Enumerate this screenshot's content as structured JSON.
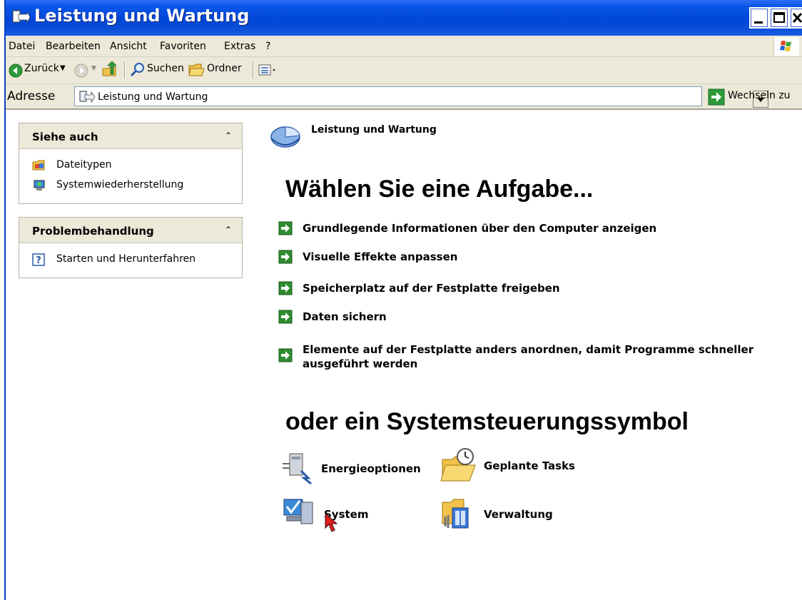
{
  "window": {
    "title": "Leistung und Wartung"
  },
  "menu": [
    "Datei",
    "Bearbeiten",
    "Ansicht",
    "Favoriten",
    "Extras",
    "?"
  ],
  "toolbar": {
    "back_label": "Zurück",
    "search_label": "Suchen",
    "folders_label": "Ordner"
  },
  "address": {
    "label": "Adresse",
    "value": "Leistung und Wartung",
    "go_label": "Wechseln zu"
  },
  "sidebar": {
    "see_also": {
      "title": "Siehe auch",
      "items": [
        "Dateitypen",
        "Systemwiederherstellung"
      ]
    },
    "troubleshoot": {
      "title": "Problembehandlung",
      "items": [
        "Starten und Herunterfahren"
      ]
    }
  },
  "main": {
    "category_title": "Leistung und Wartung",
    "task_heading": "Wählen Sie eine Aufgabe...",
    "tasks": [
      "Grundlegende Informationen über den Computer anzeigen",
      "Visuelle Effekte anpassen",
      "Speicherplatz auf der Festplatte freigeben",
      "Daten sichern",
      "Elemente auf der Festplatte anders anordnen, damit Programme schneller ausgeführt werden"
    ],
    "cpl_heading": "oder ein Systemsteuerungssymbol",
    "cpl_items": [
      "Energieoptionen",
      "Geplante Tasks",
      "System",
      "Verwaltung"
    ]
  },
  "colors": {
    "titlebar": "#0046d8",
    "task_arrow": "#2e8b2e",
    "chrome": "#ece9d8"
  }
}
